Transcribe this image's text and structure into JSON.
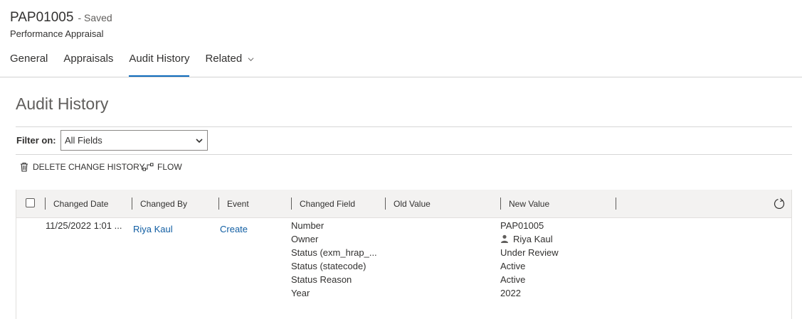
{
  "record": {
    "name": "PAP01005",
    "status": "- Saved",
    "entity": "Performance Appraisal"
  },
  "tabs": [
    {
      "label": "General"
    },
    {
      "label": "Appraisals"
    },
    {
      "label": "Audit History"
    },
    {
      "label": "Related"
    }
  ],
  "active_tab": "Audit History",
  "audit": {
    "title": "Audit History",
    "filter_label": "Filter on:",
    "filter_value": "All Fields",
    "commands": {
      "delete": "DELETE CHANGE HISTORY",
      "flow": "FLOW"
    },
    "columns": [
      "Changed Date",
      "Changed By",
      "Event",
      "Changed Field",
      "Old Value",
      "New Value"
    ],
    "rows": [
      {
        "changed_date": "11/25/2022 1:01 ...",
        "changed_by": "Riya Kaul",
        "event": "Create",
        "fields": [
          "Number",
          "Owner",
          "Status (exm_hrap_...",
          "Status (statecode)",
          "Status Reason",
          "Year"
        ],
        "new_values": [
          "PAP01005",
          "Riya Kaul",
          "Under Review",
          "Active",
          "Active",
          "2022"
        ]
      }
    ]
  },
  "icons": {
    "chevron": "chevron-down-icon",
    "delete": "trash-icon",
    "flow": "flow-icon",
    "refresh": "refresh-icon",
    "person": "person-icon"
  },
  "colors": {
    "accent": "#0f6cbd",
    "link": "#115ea3",
    "header_bg": "#f3f2f1"
  }
}
